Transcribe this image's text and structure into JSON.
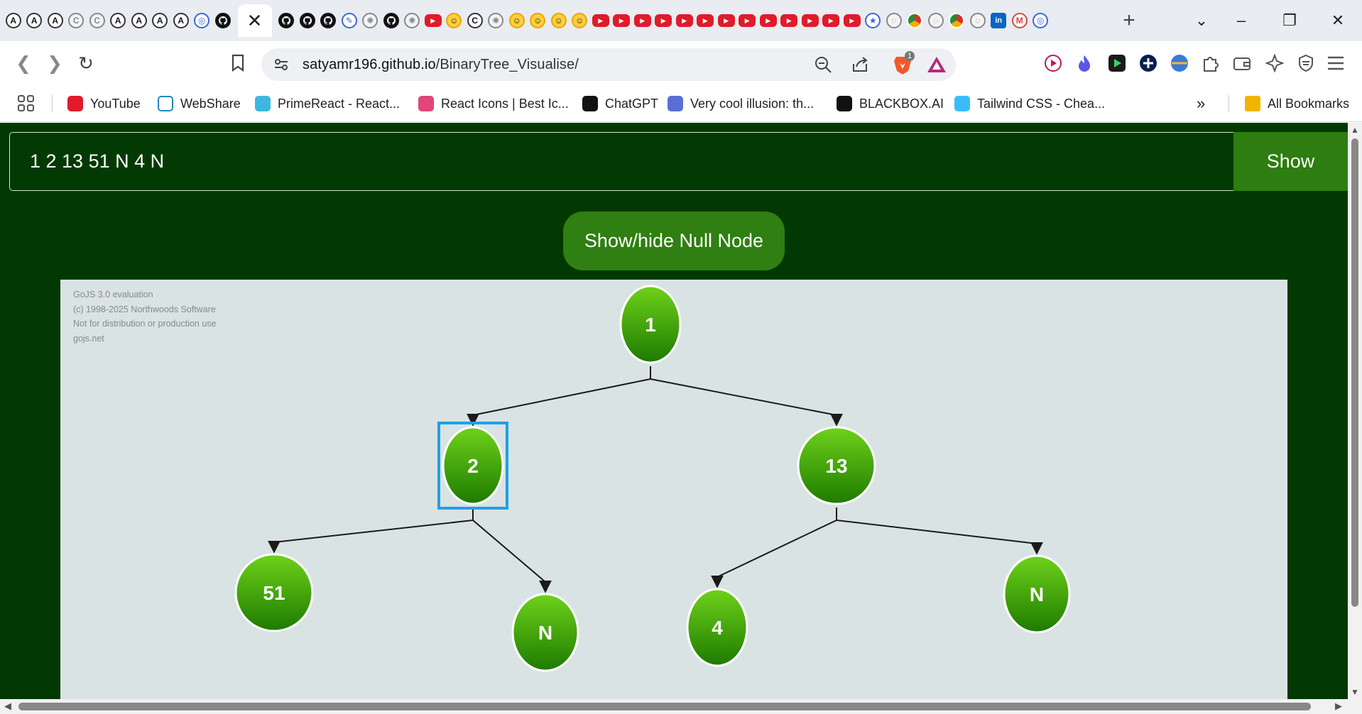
{
  "browser": {
    "tab_icons": [
      "a-icon",
      "a-icon",
      "a-icon",
      "circle-icon",
      "circle-icon",
      "a-icon",
      "a-icon",
      "a-icon",
      "a-icon",
      "globe-icon",
      "github-icon",
      "active-tab",
      "github-icon",
      "github-icon",
      "github-icon",
      "chat-icon",
      "openai-icon",
      "github-icon",
      "openai-icon",
      "youtube-icon",
      "yellow-icon",
      "c-icon",
      "openai-icon",
      "yellow-icon",
      "yellow-icon",
      "yellow-icon",
      "yellow-icon",
      "youtube-icon",
      "youtube-icon",
      "youtube-icon",
      "youtube-icon",
      "youtube-icon",
      "youtube-icon",
      "youtube-icon",
      "youtube-icon",
      "youtube-icon",
      "youtube-icon",
      "youtube-icon",
      "youtube-icon",
      "youtube-icon",
      "blue-icon",
      "grey-icon",
      "chrome-icon",
      "grey-icon",
      "chrome-icon",
      "grey-icon",
      "linkedin-icon",
      "gmail-icon",
      "globe-icon"
    ],
    "active_tab_close": "✕",
    "new_tab": "+",
    "url_host": "satyamr196.github.io",
    "url_path": "/BinaryTree_Visualise/",
    "brave_badge": "1",
    "bookmarks": [
      {
        "label": "YouTube",
        "color": "#e01b2a"
      },
      {
        "label": "WebShare",
        "color": "#ffffff"
      },
      {
        "label": "PrimeReact - React...",
        "color": "#3fb6e0"
      },
      {
        "label": "React Icons | Best Ic...",
        "color": "#e0457b"
      },
      {
        "label": "ChatGPT",
        "color": "#111111"
      },
      {
        "label": "Very cool illusion: th...",
        "color": "#5a6fd6"
      },
      {
        "label": "BLACKBOX.AI",
        "color": "#111111"
      },
      {
        "label": "Tailwind CSS - Chea...",
        "color": "#38bdf8"
      }
    ],
    "bookmarks_overflow": "»",
    "all_bookmarks": "All Bookmarks"
  },
  "app": {
    "input_value": "1 2 13 51 N 4 N",
    "show_button": "Show",
    "null_toggle_button": "Show/hide Null Node",
    "watermark": [
      "GoJS 3.0 evaluation",
      "(c) 1998-2025 Northwoods Software",
      "Not for distribution or production use",
      "gojs.net"
    ]
  },
  "tree": {
    "nodes": [
      {
        "id": "root",
        "label": "1",
        "parent": null
      },
      {
        "id": "n2",
        "label": "2",
        "parent": "root",
        "selected": true
      },
      {
        "id": "n13",
        "label": "13",
        "parent": "root"
      },
      {
        "id": "n51",
        "label": "51",
        "parent": "n2"
      },
      {
        "id": "n2N",
        "label": "N",
        "parent": "n2"
      },
      {
        "id": "n4",
        "label": "4",
        "parent": "n13"
      },
      {
        "id": "n13N",
        "label": "N",
        "parent": "n13"
      }
    ],
    "colors": {
      "node_top": "#6ed21a",
      "node_bottom": "#1e7a00",
      "selection": "#1ea0e8",
      "edge": "#1a1a1a"
    }
  }
}
